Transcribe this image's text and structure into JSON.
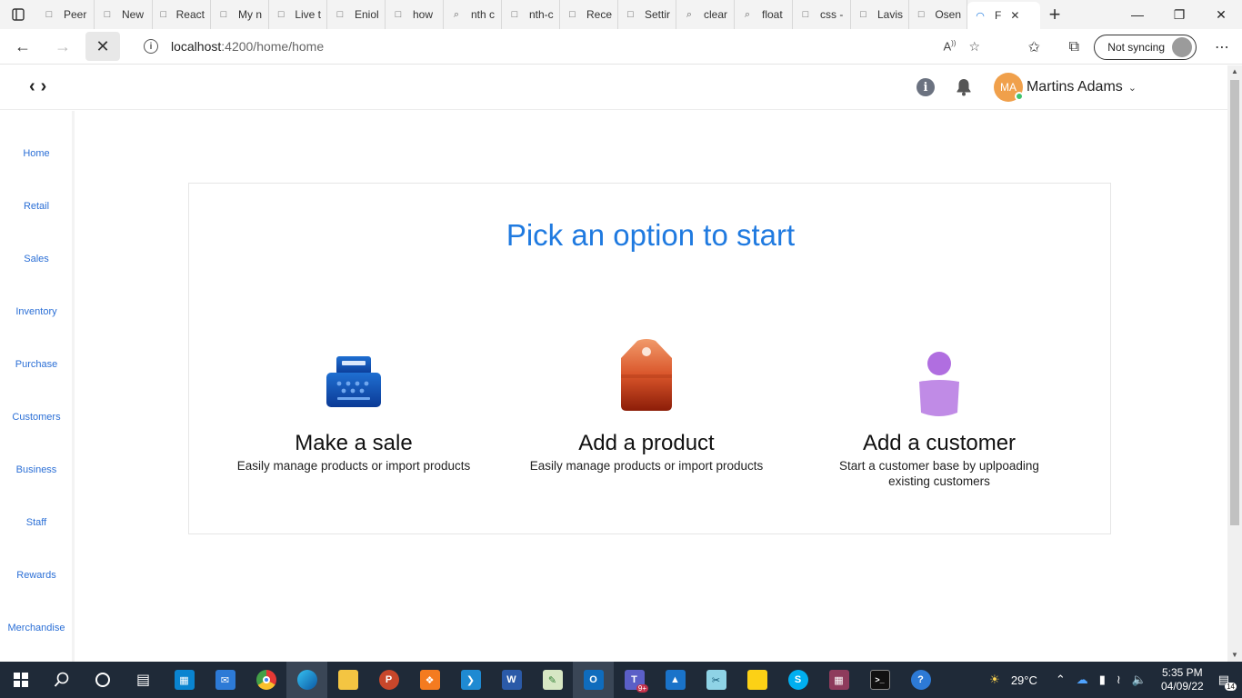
{
  "browser": {
    "tabs": [
      {
        "label": "Peer",
        "icon": "cloud-icon"
      },
      {
        "label": "New",
        "icon": "newtab-icon"
      },
      {
        "label": "React",
        "icon": "react-icon"
      },
      {
        "label": "My n",
        "icon": "arrow-icon"
      },
      {
        "label": "Live t",
        "icon": "page-icon"
      },
      {
        "label": "Eniol",
        "icon": "pdf-icon"
      },
      {
        "label": "how",
        "icon": "bing-icon"
      },
      {
        "label": "nth c",
        "icon": "search-icon"
      },
      {
        "label": "nth-c",
        "icon": "medium-icon"
      },
      {
        "label": "Rece",
        "icon": "page-icon"
      },
      {
        "label": "Settir",
        "icon": "gear-icon"
      },
      {
        "label": "clear",
        "icon": "search-icon"
      },
      {
        "label": "float",
        "icon": "search-icon"
      },
      {
        "label": "css -",
        "icon": "stack-icon"
      },
      {
        "label": "Lavis",
        "icon": "page-icon"
      },
      {
        "label": "Osen",
        "icon": "page-icon"
      },
      {
        "label": "F",
        "icon": "loading-icon",
        "active": true
      }
    ],
    "address": {
      "host": "localhost",
      "path": ":4200/home/home"
    },
    "sync_label": "Not syncing"
  },
  "app": {
    "user": {
      "initials": "MA",
      "name": "Martins Adams"
    },
    "sidebar": [
      "Home",
      "Retail",
      "Sales",
      "Inventory",
      "Purchase",
      "Customers",
      "Business",
      "Staff",
      "Rewards",
      "Merchandise"
    ],
    "page_title": "Pick an option to start",
    "options": [
      {
        "title": "Make a sale",
        "description": "Easily manage products or import products",
        "icon": "cash-register-icon"
      },
      {
        "title": "Add a product",
        "description": "Easily manage products or import products",
        "icon": "price-tag-icon"
      },
      {
        "title": "Add a customer",
        "description": "Start a customer base by uplpoading existing customers",
        "icon": "person-icon"
      }
    ]
  },
  "taskbar": {
    "weather": "29°C",
    "time": "5:35 PM",
    "date": "04/09/22",
    "notifications": "14",
    "teams_badge": "9+"
  },
  "colors": {
    "accent": "#1f7ae0",
    "sidebar_link": "#2b6fd6",
    "avatar": "#f0a04b",
    "online": "#3fc36e"
  }
}
